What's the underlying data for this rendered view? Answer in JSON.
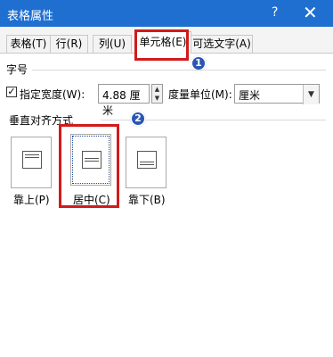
{
  "window": {
    "title": "表格属性",
    "help_label": "?",
    "close_label": "✕"
  },
  "tabs": [
    {
      "label": "表格(T)"
    },
    {
      "label": "行(R)"
    },
    {
      "label": "列(U)"
    },
    {
      "label": "单元格(E)"
    },
    {
      "label": "可选文字(A)"
    }
  ],
  "active_tab": "单元格(E)",
  "size_section": {
    "label": "字号",
    "specify_width_label": "指定宽度(W):",
    "width_checked": true,
    "width_value": "4.88 厘米",
    "measure_label": "度量单位(M):",
    "measure_value": "厘米"
  },
  "valign_section": {
    "label": "垂直对齐方式",
    "options": [
      {
        "label": "靠上(P)"
      },
      {
        "label": "居中(C)"
      },
      {
        "label": "靠下(B)"
      }
    ],
    "selected": "居中(C)"
  },
  "annotations": {
    "badge_1": "1",
    "badge_2": "2",
    "highlight_color": "#d11b1b",
    "badge_color": "#2a56b3"
  },
  "colors": {
    "titlebar": "#1f6fd0"
  }
}
